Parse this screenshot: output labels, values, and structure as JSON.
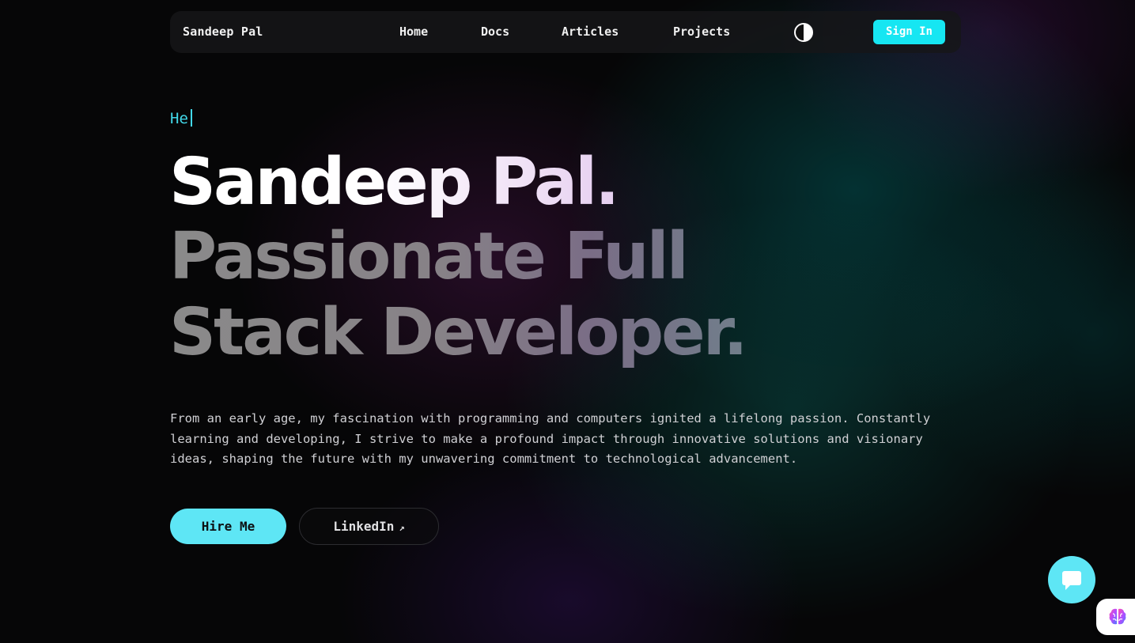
{
  "nav": {
    "brand": "Sandeep Pal",
    "links": [
      "Home",
      "Docs",
      "Articles",
      "Projects"
    ],
    "signin_label": "Sign In"
  },
  "hero": {
    "typing_text": "He",
    "name": "Sandeep Pal.",
    "role": "Passionate Full Stack Developer.",
    "description": "From an early age, my fascination with programming and computers ignited a lifelong passion. Constantly learning and developing, I strive to make a profound impact through innovative solutions and visionary ideas, shaping the future with my unwavering commitment to technological advancement.",
    "hire_label": "Hire Me",
    "linkedin_label": "LinkedIn",
    "linkedin_arrow": "↗"
  },
  "icons": {
    "theme_toggle": "half-circle-contrast-icon",
    "chat": "chat-bubble-icon",
    "ai_widget": "brain-icon"
  },
  "colors": {
    "accent": "#5ee6f5",
    "signin_bg": "#16e6f2",
    "typing": "#42d9ea",
    "background": "#060607"
  }
}
